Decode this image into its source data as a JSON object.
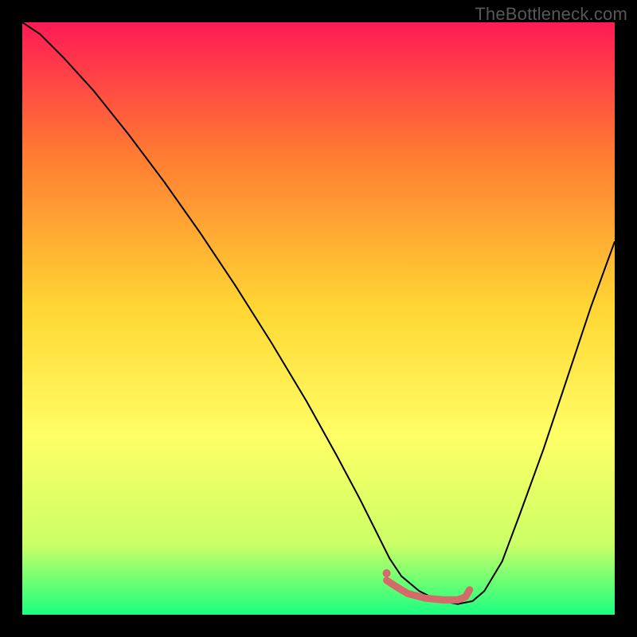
{
  "watermark": "TheBottleneck.com",
  "chart_data": {
    "type": "line",
    "title": "",
    "xlabel": "",
    "ylabel": "",
    "xlim": [
      0,
      100
    ],
    "ylim": [
      0,
      100
    ],
    "grid": false,
    "legend": false,
    "annotations": [],
    "background_gradient": {
      "top": "#ff1a55",
      "mid_upper": "#ff7a33",
      "mid": "#ffd633",
      "mid_lower": "#ffff66",
      "near_bottom": "#ccff66",
      "bottom": "#1aff80"
    },
    "series": [
      {
        "name": "bottleneck-curve",
        "color": "#000000",
        "stroke_width": 2,
        "x": [
          0,
          3,
          7,
          12,
          18,
          24,
          30,
          36,
          42,
          48,
          53,
          57,
          60,
          62,
          64,
          67,
          70,
          73.5,
          76,
          78,
          81,
          84,
          88,
          92,
          96,
          100
        ],
        "y": [
          100,
          98,
          94,
          88.5,
          81,
          73,
          64.5,
          55.5,
          46,
          36,
          27,
          19.5,
          13.5,
          9.5,
          6.5,
          4,
          2.5,
          1.8,
          2.3,
          4,
          9,
          17,
          28,
          40,
          52,
          63
        ]
      }
    ],
    "highlight_segment": {
      "name": "flat-minimum",
      "color": "#d46a6a",
      "stroke_width": 9,
      "x": [
        61.5,
        63,
        65,
        68,
        71,
        73.5,
        74.8,
        75.5
      ],
      "y": [
        5.8,
        4.8,
        3.6,
        2.8,
        2.5,
        2.5,
        3.0,
        4.2
      ]
    },
    "highlight_point": {
      "name": "optimal-point",
      "color": "#d46a6a",
      "x": 61.5,
      "y": 7.0,
      "radius": 5
    }
  }
}
